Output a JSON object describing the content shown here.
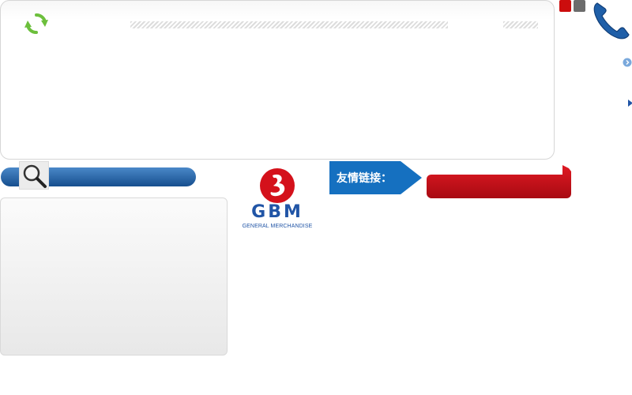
{
  "friend_links": {
    "label": "友情链接："
  },
  "logo": {
    "brand": "GBM",
    "tagline": "GENERAL MERCHANDISE"
  },
  "colors": {
    "brand_blue": "#2155a6",
    "accent_red": "#cc0d0d",
    "tab_blue": "#1570c0",
    "refresh_green": "#6cbf3c"
  },
  "icons": [
    "refresh-icon",
    "phone-icon",
    "search-icon",
    "circle-arrow-icon",
    "triangle-right-icon"
  ]
}
